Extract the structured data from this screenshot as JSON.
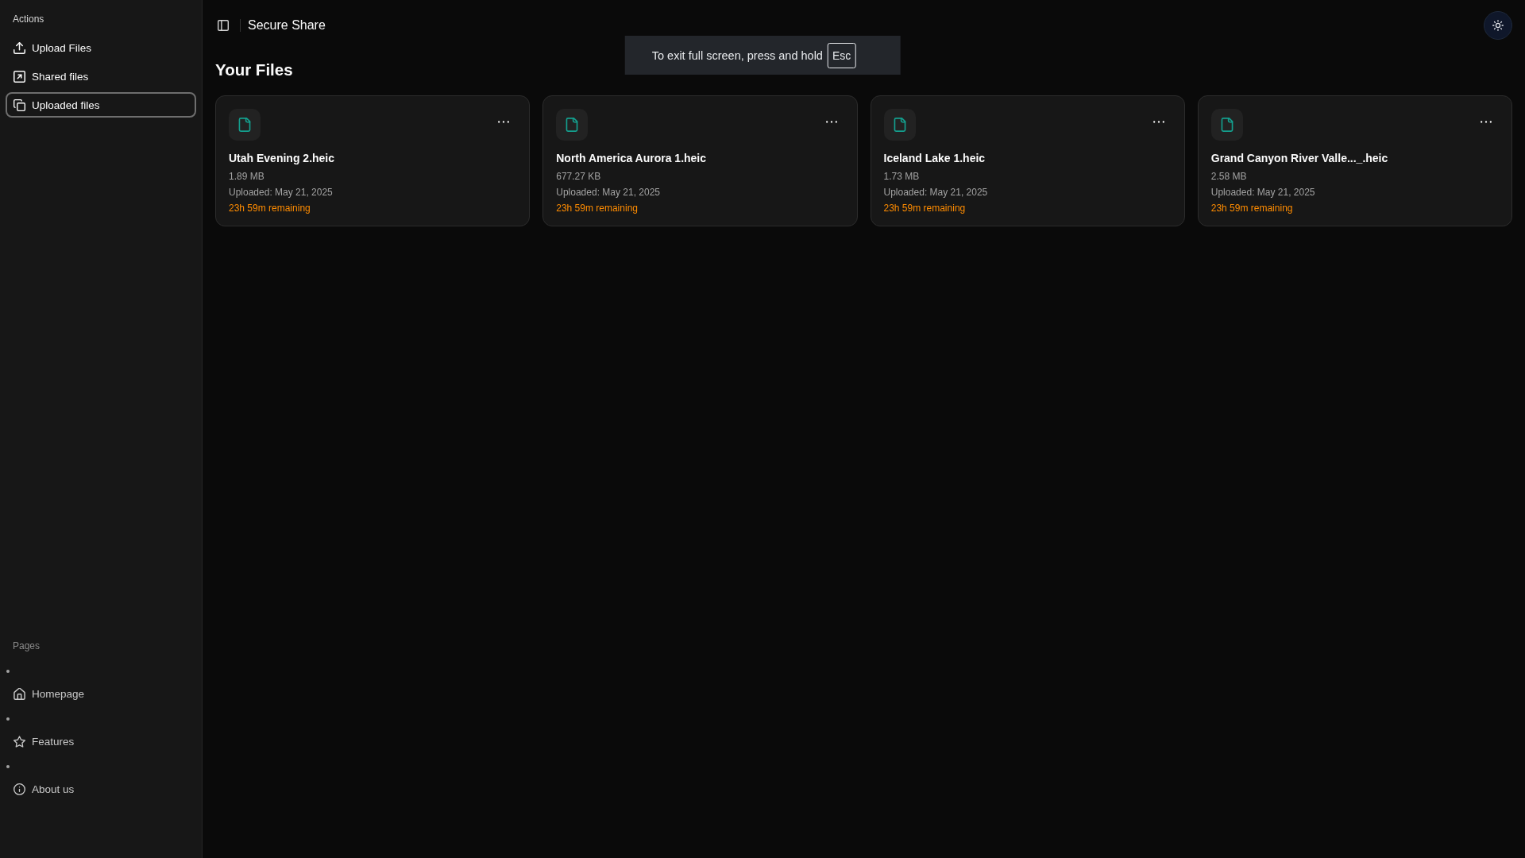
{
  "sidebar": {
    "groups": [
      {
        "label": "Actions",
        "kind": "menu",
        "items": [
          {
            "label": "Upload Files",
            "selected": false
          },
          {
            "label": "Shared files",
            "selected": false
          },
          {
            "label": "Uploaded files",
            "selected": true
          }
        ]
      },
      {
        "label": "Pages",
        "kind": "bulleted",
        "items": [
          {
            "label": "Homepage",
            "selected": false
          },
          {
            "label": "Features",
            "selected": false
          },
          {
            "label": "About us",
            "selected": false
          }
        ]
      }
    ]
  },
  "header": {
    "title": "Secure Share"
  },
  "fullscreen_notice": {
    "message": "To exit full screen, press and hold",
    "key": "Esc"
  },
  "page": {
    "heading": "Your Files"
  },
  "files": [
    {
      "name": "Utah Evening 2.heic",
      "size": "1.89 MB",
      "uploaded": "Uploaded: May 21, 2025",
      "remaining": "23h 59m remaining"
    },
    {
      "name": "North America Aurora 1.heic",
      "size": "677.27 KB",
      "uploaded": "Uploaded: May 21, 2025",
      "remaining": "23h 59m remaining"
    },
    {
      "name": "Iceland Lake 1.heic",
      "size": "1.73 MB",
      "uploaded": "Uploaded: May 21, 2025",
      "remaining": "23h 59m remaining"
    },
    {
      "name": "Grand Canyon River Valle..._.heic",
      "size": "2.58 MB",
      "uploaded": "Uploaded: May 21, 2025",
      "remaining": "23h 59m remaining"
    }
  ]
}
